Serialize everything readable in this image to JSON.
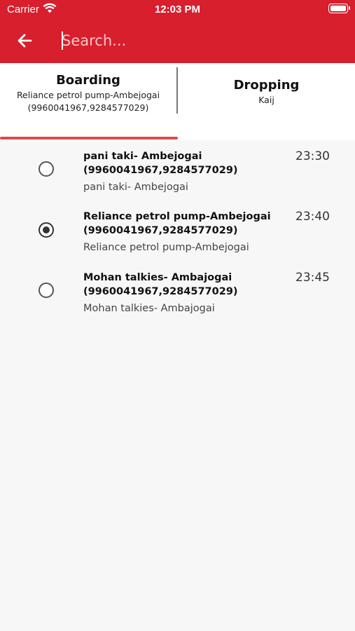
{
  "status_bar": {
    "carrier": "Carrier",
    "time": "12:03 PM"
  },
  "search": {
    "placeholder": "Search...",
    "value": ""
  },
  "colors": {
    "header": "#d71f2d",
    "indicator": "#e4474b",
    "background": "#f7f7f7"
  },
  "tabs": {
    "boarding": {
      "title": "Boarding",
      "point": "Reliance petrol pump-Ambejogai",
      "phones": "(9960041967,9284577029)",
      "active": true
    },
    "dropping": {
      "title": "Dropping",
      "point": "Kaij",
      "active": false
    }
  },
  "stops": [
    {
      "name": "pani taki- Ambejogai",
      "phones": "(9960041967,9284577029)",
      "address": "pani taki- Ambejogai",
      "time": "23:30",
      "selected": false
    },
    {
      "name": "Reliance petrol pump-Ambejogai",
      "phones": "(9960041967,9284577029)",
      "address": "Reliance petrol pump-Ambejogai",
      "time": "23:40",
      "selected": true
    },
    {
      "name": "Mohan talkies- Ambajogai",
      "phones": "(9960041967,9284577029)",
      "address": "Mohan talkies- Ambajogai",
      "time": "23:45",
      "selected": false
    }
  ],
  "icons": {
    "back": "arrow-left-icon",
    "wifi": "wifi-icon",
    "battery": "battery-icon"
  }
}
